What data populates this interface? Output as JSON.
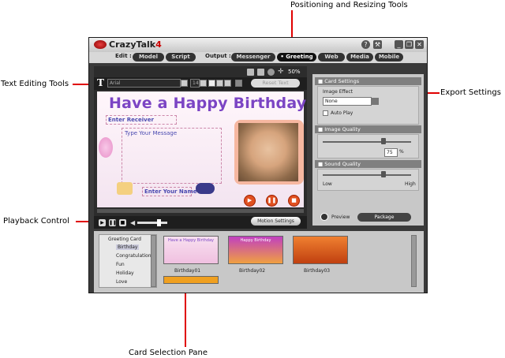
{
  "callouts": {
    "positioning": "Positioning and Resizing Tools",
    "text_editing": "Text Editing Tools",
    "export": "Export Settings",
    "playback": "Playback Control",
    "card_selection": "Card Selection Pane"
  },
  "app": {
    "name": "CrazyTalk",
    "version": "4"
  },
  "menu": {
    "edit_label": "Edit :",
    "model": "Model",
    "script": "Script",
    "output_label": "Output :",
    "messenger": "Messenger",
    "greeting": "Greeting",
    "web": "Web",
    "media": "Media",
    "mobile": "Mobile"
  },
  "toolbar": {
    "zoom": "50%",
    "font": "Arial",
    "font_size": "14",
    "reset_text": "Reset Text"
  },
  "card": {
    "title": "Have a Happy Birthday",
    "receiver": "Enter Receiver",
    "message": "Type Your Message",
    "name": "Enter Your Name"
  },
  "playback": {
    "motion_settings": "Motion Settings"
  },
  "export": {
    "card_settings": "Card Settings",
    "image_effect_label": "Image Effect",
    "image_effect_value": "None",
    "auto_play": "Auto Play",
    "image_quality": "Image Quality",
    "image_quality_value": "75",
    "percent": "%",
    "sound_quality": "Sound Quality",
    "low": "Low",
    "high": "High",
    "preview": "Preview",
    "package": "Package"
  },
  "card_pane": {
    "tree_root": "Greeting Card",
    "tree_items": [
      "Birthday",
      "Congratulation",
      "Fun",
      "Holiday",
      "Love"
    ],
    "thumbs": [
      "Birthday01",
      "Birthday02",
      "Birthday03"
    ],
    "thumb1_text": "Have a Happy Birthday",
    "thumb2_text": "Happy Birthday"
  },
  "colors": {
    "callout_red": "#e00000",
    "title_purple": "#7b44c4",
    "app_dark": "#3a3a3a"
  }
}
